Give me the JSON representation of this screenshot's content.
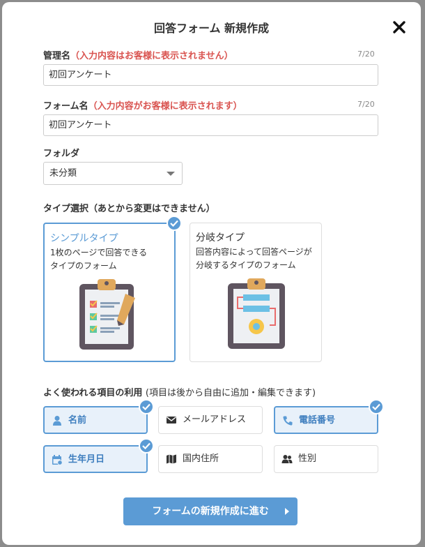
{
  "dialog": {
    "title": "回答フォーム 新規作成",
    "close_icon": "close-icon"
  },
  "admin_name": {
    "label": "管理名",
    "note": "（入力内容はお客様に表示されません）",
    "counter": "7/20",
    "value": "初回アンケート"
  },
  "form_name": {
    "label": "フォーム名",
    "note": "（入力内容がお客様に表示されます）",
    "counter": "7/20",
    "value": "初回アンケート"
  },
  "folder": {
    "label": "フォルダ",
    "selected": "未分類"
  },
  "type_select": {
    "label": "タイプ選択（あとから変更はできません）",
    "options": [
      {
        "name": "シンプルタイプ",
        "desc_line1": "1枚のページで回答できる",
        "desc_line2": "タイプのフォーム",
        "selected": true,
        "icon": "clipboard-checklist-icon"
      },
      {
        "name": "分岐タイプ",
        "desc_line1": "回答内容によって回答ページが",
        "desc_line2": "分岐するタイプのフォーム",
        "selected": false,
        "icon": "clipboard-flow-icon"
      }
    ]
  },
  "common_items": {
    "label": "よく使われる項目の利用",
    "note": "(項目は後から自由に追加・編集できます)",
    "items": [
      {
        "label": "名前",
        "icon": "person-icon",
        "selected": true
      },
      {
        "label": "メールアドレス",
        "icon": "envelope-icon",
        "selected": false
      },
      {
        "label": "電話番号",
        "icon": "phone-icon",
        "selected": true
      },
      {
        "label": "生年月日",
        "icon": "calendar-icon",
        "selected": true
      },
      {
        "label": "国内住所",
        "icon": "map-icon",
        "selected": false
      },
      {
        "label": "性別",
        "icon": "users-icon",
        "selected": false
      }
    ]
  },
  "submit": {
    "label": "フォームの新規作成に進む"
  },
  "colors": {
    "accent": "#5b9bd5",
    "note_red": "#d9534f"
  }
}
